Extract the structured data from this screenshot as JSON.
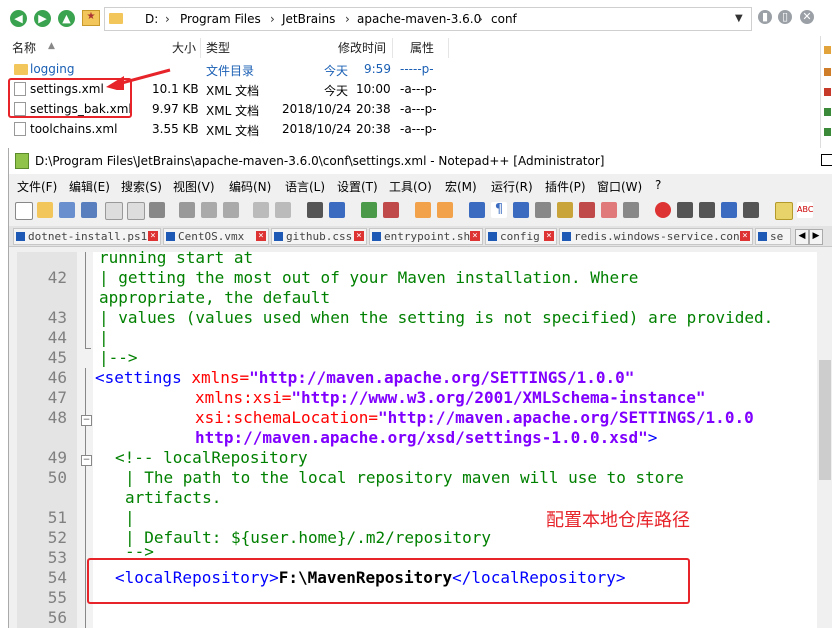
{
  "explorer": {
    "address": [
      "D:",
      "Program Files",
      "JetBrains",
      "apache-maven-3.6.0",
      "conf"
    ],
    "columns": {
      "name": "名称",
      "size": "大小",
      "type": "类型",
      "modified": "修改时间",
      "attr": "属性"
    },
    "files": [
      {
        "name": "logging",
        "size": "",
        "type": "文件目录",
        "date": "今天",
        "time": "9:59",
        "attr": "-----p-"
      },
      {
        "name": "settings.xml",
        "size": "10.1 KB",
        "type": "XML 文档",
        "date": "今天",
        "time": "10:00",
        "attr": "-a---p-"
      },
      {
        "name": "settings_bak.xml",
        "size": "9.97 KB",
        "type": "XML 文档",
        "date": "2018/10/24",
        "time": "20:38",
        "attr": "-a---p-"
      },
      {
        "name": "toolchains.xml",
        "size": "3.55 KB",
        "type": "XML 文档",
        "date": "2018/10/24",
        "time": "20:38",
        "attr": "-a---p-"
      }
    ]
  },
  "notepad": {
    "title": "D:\\Program Files\\JetBrains\\apache-maven-3.6.0\\conf\\settings.xml - Notepad++ [Administrator]",
    "menus": [
      "文件(F)",
      "编辑(E)",
      "搜索(S)",
      "视图(V)",
      "编码(N)",
      "语言(L)",
      "设置(T)",
      "工具(O)",
      "宏(M)",
      "运行(R)",
      "插件(P)",
      "窗口(W)",
      "?"
    ],
    "tabs": [
      "dotnet-install.ps1",
      "CentOS.vmx",
      "github.css",
      "entrypoint.sh",
      "config",
      "redis.windows-service.conf",
      "se"
    ],
    "code": {
      "l41": "running start at",
      "n42": "42",
      "l42a": "| getting the most out of your Maven installation. Where",
      "l42b": "appropriate, the default",
      "n43": "43",
      "l43": "| values (values used when the setting is not specified) are provided.",
      "n44": "44",
      "l44": "|",
      "n45": "45",
      "l45": "|-->",
      "n46": "46",
      "l46_tag": "<settings ",
      "l46_attr": "xmlns=",
      "l46_val": "\"http://maven.apache.org/SETTINGS/1.0.0\"",
      "n47": "47",
      "l47_attr": "xmlns:xsi=",
      "l47_val": "\"http://www.w3.org/2001/XMLSchema-instance\"",
      "n48": "48",
      "l48_attr": "xsi:schemaLocation=",
      "l48_val": "\"http://maven.apache.org/SETTINGS/1.0.0",
      "l48b_val": "http://maven.apache.org/xsd/settings-1.0.0.xsd\"",
      "l48b_tag": ">",
      "n49": "49",
      "l49": "<!-- localRepository",
      "n50": "50",
      "l50a": "| The path to the local repository maven will use to store",
      "l50b": "artifacts.",
      "n51": "51",
      "l51": "|",
      "n52": "52",
      "l52": "| Default: ${user.home}/.m2/repository",
      "n53": "53",
      "l53": "-->",
      "n54": "54",
      "l54_open": "<localRepository>",
      "l54_val": "F:\\MavenRepository",
      "l54_close": "</localRepository>",
      "n55": "55",
      "n56": "56"
    }
  },
  "annotation": "配置本地仓库路径",
  "colors": {
    "highlight": "#e6242a",
    "tag": "#0000ff",
    "attr": "#ff0000",
    "value": "#8000ff",
    "comment": "#008000"
  }
}
